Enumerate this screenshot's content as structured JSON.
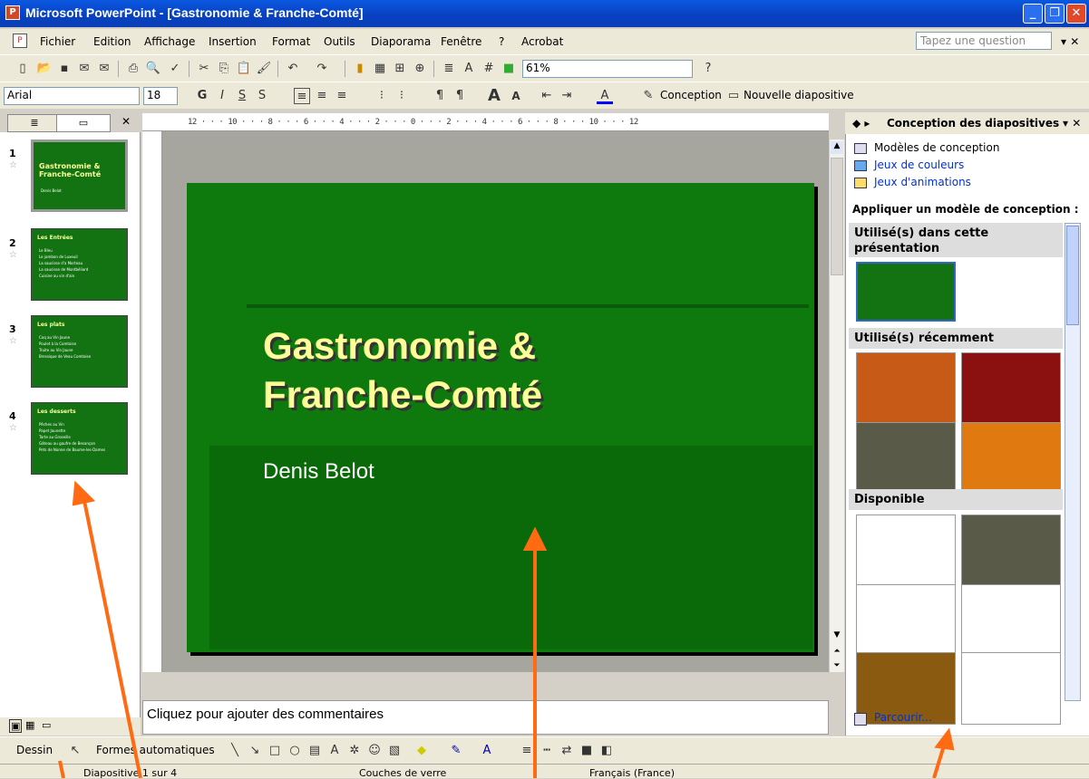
{
  "window": {
    "title": "Microsoft PowerPoint - [Gastronomie & Franche-Comté]"
  },
  "menu": [
    "Fichier",
    "Edition",
    "Affichage",
    "Insertion",
    "Format",
    "Outils",
    "Diaporama",
    "Fenêtre",
    "?",
    "Acrobat"
  ],
  "question_placeholder": "Tapez une question",
  "toolbar": {
    "zoom": "61%",
    "font": "Arial",
    "size": "18",
    "conception_label": "Conception",
    "new_slide_label": "Nouvelle diapositive"
  },
  "ruler_text": "12 · · · 10 · · · 8 · · · 6 · · · 4 · · · 2 · · · 0 · · · 2 · · · 4 · · · 6 · · · 8 · · · 10 · · · 12",
  "thumbnails": [
    {
      "num": "1",
      "title": "Gastronomie & Franche-Comté",
      "body": "Denis Belot"
    },
    {
      "num": "2",
      "title": "Les Entrées",
      "body": "Le Bleu\nLe jambon de Luxeuil\nLa saucisse d'a Morteau\nLa saucisse de Montbéliard\nCuisine au vin d'ain"
    },
    {
      "num": "3",
      "title": "Les plats",
      "body": "Coq au Vin Jaune\nPoulet à la Comtoise\nTruite au Vin Jaune\nBressique de Veau Comtoise"
    },
    {
      "num": "4",
      "title": "Les desserts",
      "body": "Pêches au Vin\nPapet Jaunette\nTarte au Groseille\nGâteau au gaufre de Besançon\nPets de Nonne de Baume-les-Dames"
    }
  ],
  "slide": {
    "title": "Gastronomie & Franche-Comté",
    "subtitle": "Denis Belot"
  },
  "notes_placeholder": "Cliquez pour ajouter des commentaires",
  "taskpane": {
    "title": "Conception des diapositives",
    "links": [
      "Modèles de conception",
      "Jeux de couleurs",
      "Jeux d'animations"
    ],
    "apply_label": "Appliquer un modèle de conception :",
    "sections": [
      "Utilisé(s) dans cette présentation",
      "Utilisé(s) récemment",
      "Disponible"
    ],
    "browse": "Parcourir..."
  },
  "drawbar": {
    "draw": "Dessin",
    "autoshapes": "Formes automatiques"
  },
  "status": {
    "slide": "Diapositive 1 sur 4",
    "theme": "Couches de verre",
    "lang": "Français (France)"
  },
  "colors": {
    "slide_green": "#0e7a0e",
    "title_yellow": "#ffff99",
    "arrow_orange": "#ff6a13"
  }
}
